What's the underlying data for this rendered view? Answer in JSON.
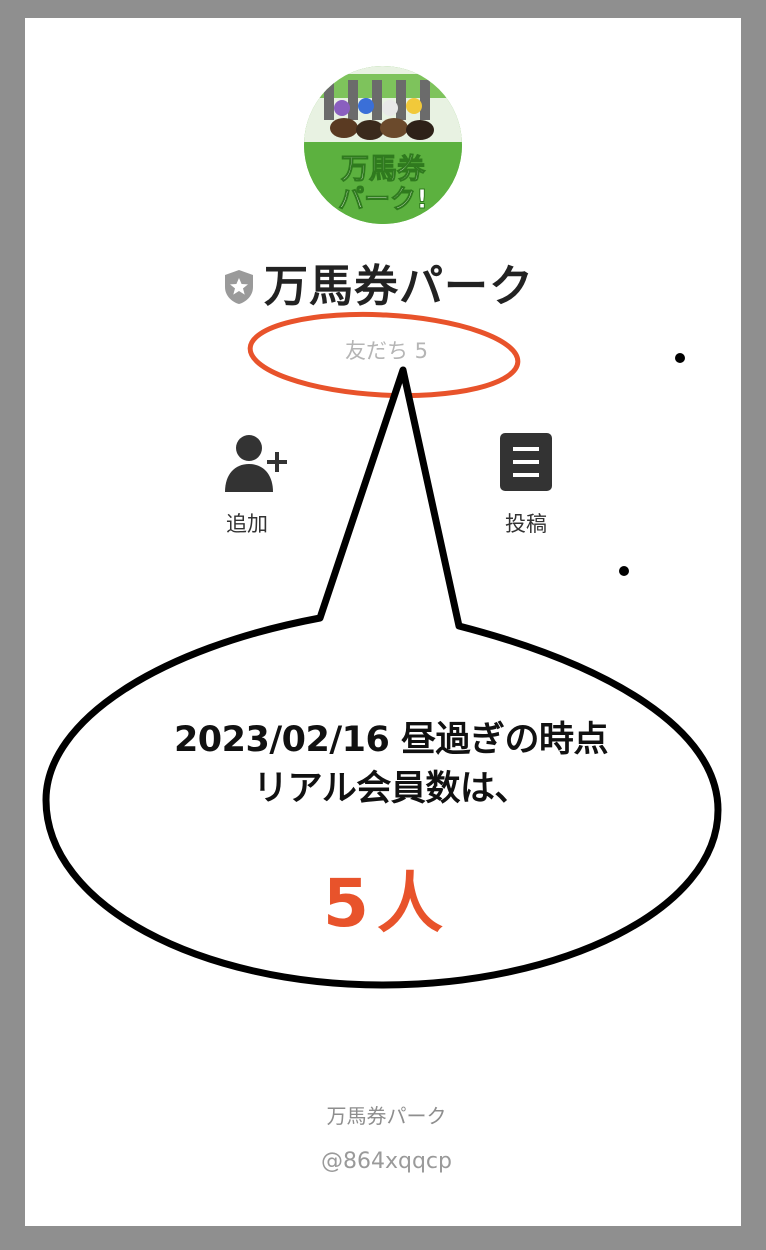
{
  "profile": {
    "name": "万馬券パーク",
    "friends_label": "友だち 5",
    "avatar_logo_text": "万馬券パーク!"
  },
  "actions": [
    {
      "label": "追加",
      "icon": "add-friend-icon"
    },
    {
      "label": "投稿",
      "icon": "post-icon"
    }
  ],
  "annotation": {
    "line1": "2023/02/16 昼過ぎの時点",
    "line2": "リアル会員数は、",
    "count": "5人",
    "highlight_color": "#e8532b"
  },
  "footer": {
    "name": "万馬券パーク",
    "id": "@864xqqcp"
  }
}
